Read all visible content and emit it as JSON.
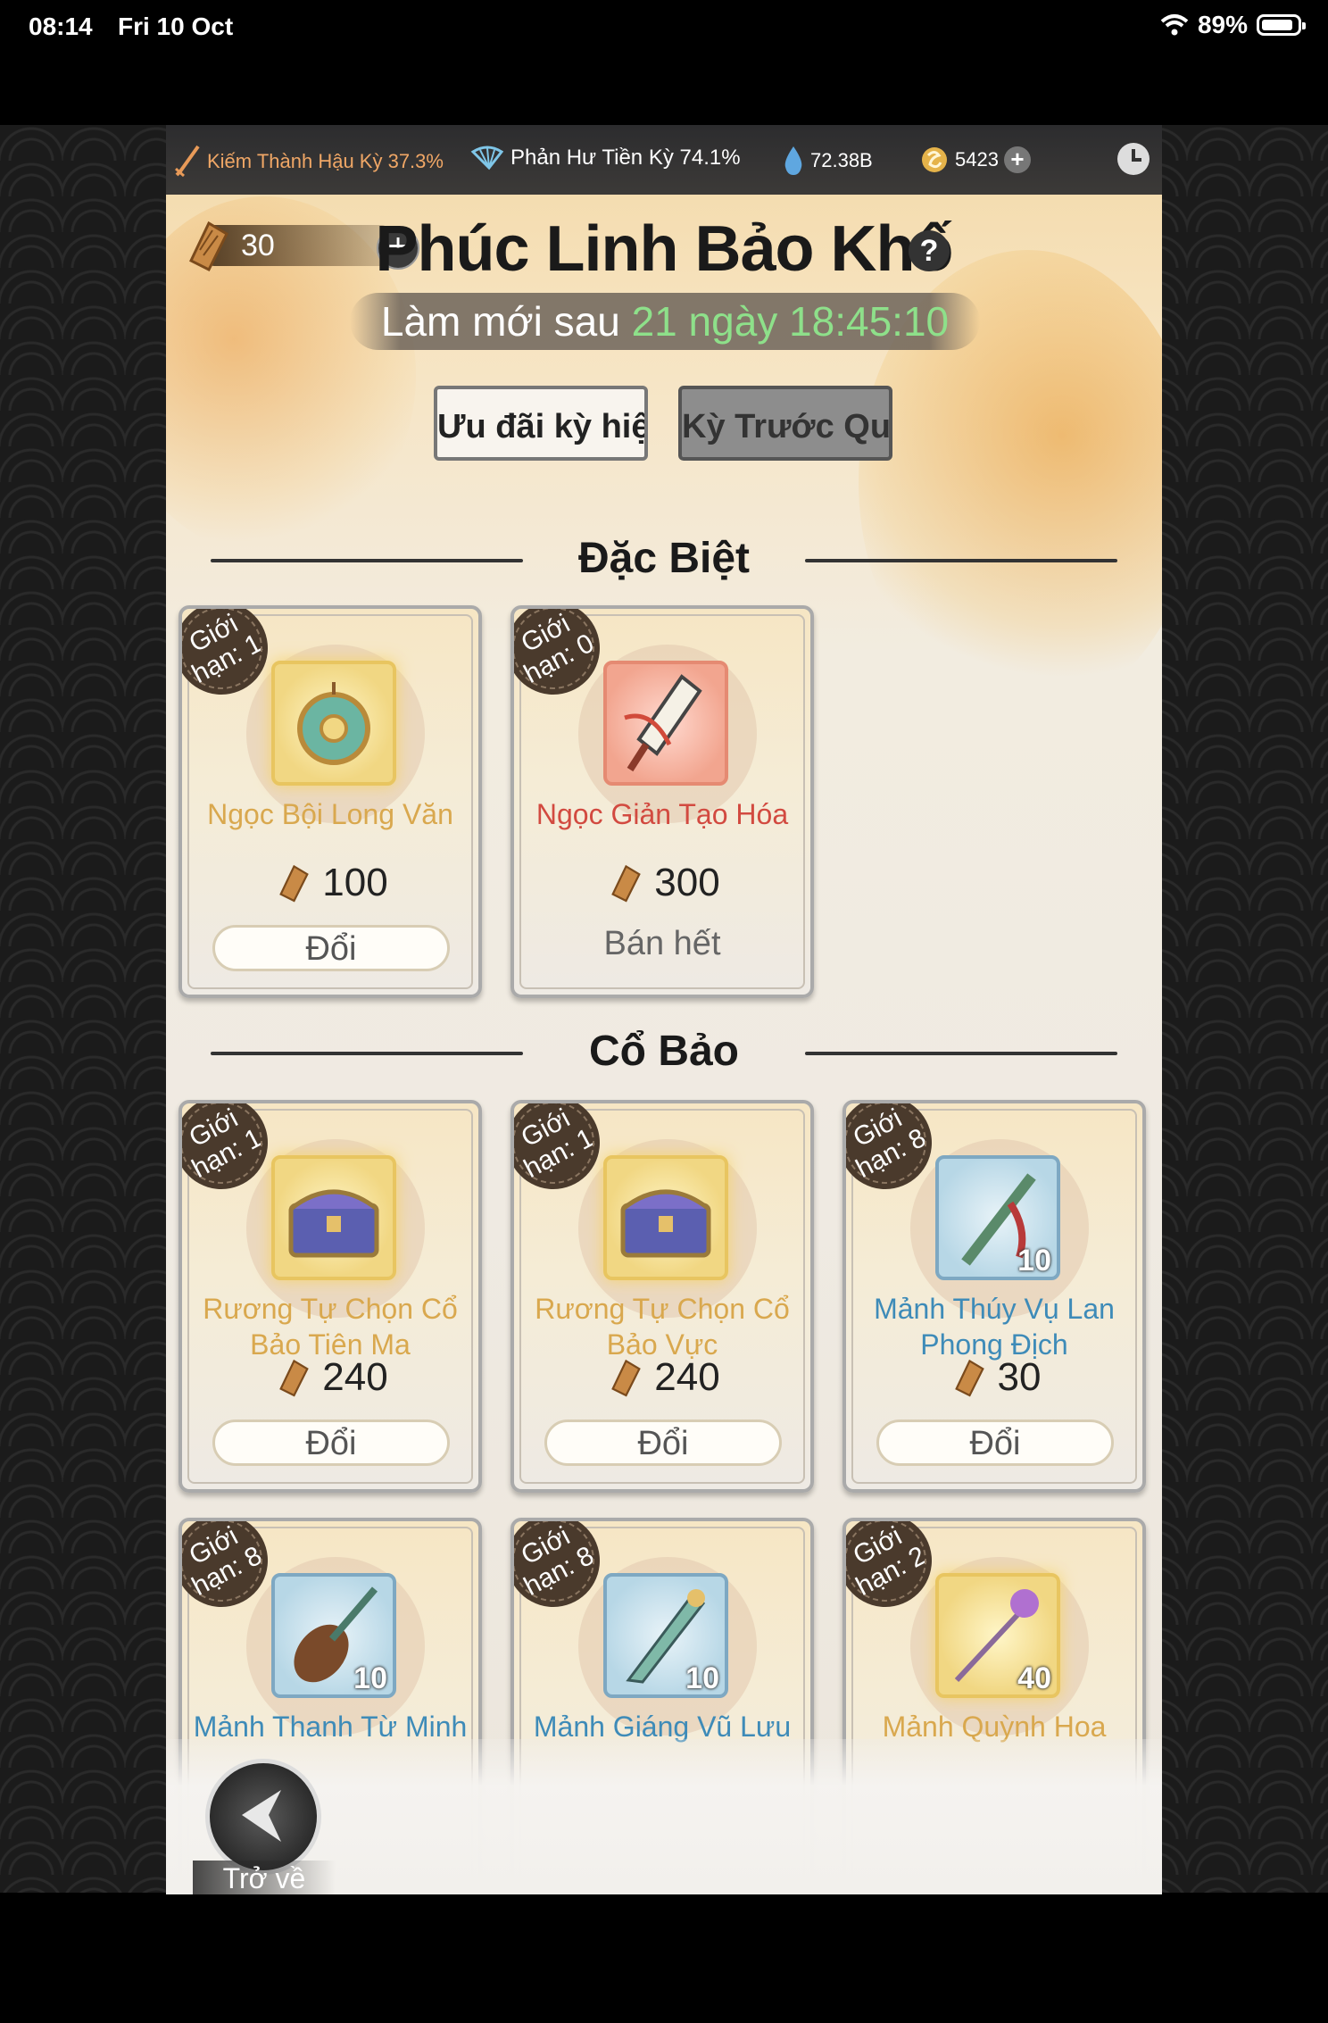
{
  "status_bar": {
    "time": "08:14",
    "date": "Fri 10 Oct",
    "battery": "89%"
  },
  "resources": {
    "item1": "Kiếm Thành Hậu Kỳ 37.3%",
    "item2": "Phản Hư Tiền Kỳ 74.1%",
    "item3": "72.38B",
    "item4": "5423"
  },
  "token_count": "30",
  "title": "Phúc Linh Bảo Khố",
  "refresh": {
    "label": "Làm mới sau",
    "time": "21 ngày 18:45:10"
  },
  "tabs": [
    {
      "label": "Ưu đãi kỳ hiện tại",
      "active": true
    },
    {
      "label": "Kỳ Trước Quay Lại",
      "active": false
    }
  ],
  "sections": {
    "special": {
      "title": "Đặc Biệt",
      "items": [
        {
          "limit": "Giới hạn: 1",
          "name": "Ngọc Bội Long Văn",
          "price": "100",
          "action": "Đổi",
          "quality": "gold"
        },
        {
          "limit": "Giới hạn: 0",
          "name": "Ngọc Giản Tạo Hóa",
          "price": "300",
          "action": "Bán hết",
          "quality": "red"
        }
      ]
    },
    "treasure": {
      "title": "Cổ Bảo",
      "items": [
        {
          "limit": "Giới hạn: 1",
          "name": "Rương Tự Chọn Cổ Bảo Tiên Ma",
          "price": "240",
          "action": "Đổi",
          "quality": "gold"
        },
        {
          "limit": "Giới hạn: 1",
          "name": "Rương Tự Chọn Cổ Bảo Vực",
          "price": "240",
          "action": "Đổi",
          "quality": "gold"
        },
        {
          "limit": "Giới hạn: 8",
          "name": "Mảnh Thúy Vụ Lan Phong Địch",
          "qty": "10",
          "price": "30",
          "action": "Đổi",
          "quality": "blue"
        },
        {
          "limit": "Giới hạn: 8",
          "name": "Mảnh Thanh Từ Minh",
          "qty": "10",
          "quality": "blue"
        },
        {
          "limit": "Giới hạn: 8",
          "name": "Mảnh Giáng Vũ Lưu",
          "qty": "10",
          "quality": "blue"
        },
        {
          "limit": "Giới hạn: 2",
          "name": "Mảnh Quỳnh Hoa",
          "qty": "40",
          "quality": "gold"
        }
      ]
    }
  },
  "back_label": "Trở về"
}
